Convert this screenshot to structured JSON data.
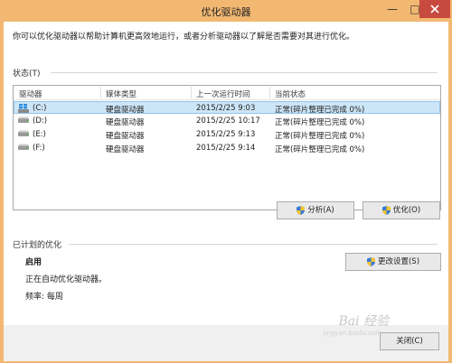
{
  "window": {
    "title": "优化驱动器",
    "minimize_glyph": "—",
    "maximize_glyph": "□",
    "accent_color": "#f2b872",
    "close_color": "#c7493f"
  },
  "intro_text": "你可以优化驱动器以帮助计算机更高效地运行，或者分析驱动器以了解是否需要对其进行优化。",
  "status": {
    "label": "状态(T)",
    "columns": [
      "驱动器",
      "媒体类型",
      "上一次运行时间",
      "当前状态"
    ],
    "rows": [
      {
        "drive": "(C:)",
        "icon": "windows-drive-icon",
        "media": "硬盘驱动器",
        "last_run": "2015/2/25 9:03",
        "state": "正常(碎片整理已完成 0%)",
        "selected": true
      },
      {
        "drive": "(D:)",
        "icon": "hard-drive-icon",
        "media": "硬盘驱动器",
        "last_run": "2015/2/25 10:17",
        "state": "正常(碎片整理已完成 0%)",
        "selected": false
      },
      {
        "drive": "(E:)",
        "icon": "hard-drive-icon",
        "media": "硬盘驱动器",
        "last_run": "2015/2/25 9:13",
        "state": "正常(碎片整理已完成 0%)",
        "selected": false
      },
      {
        "drive": "(F:)",
        "icon": "hard-drive-icon",
        "media": "硬盘驱动器",
        "last_run": "2015/2/25 9:14",
        "state": "正常(碎片整理已完成 0%)",
        "selected": false
      }
    ]
  },
  "buttons": {
    "analyze": "分析(A)",
    "optimize": "优化(O)",
    "change_settings": "更改设置(S)",
    "close": "关闭(C)"
  },
  "scheduled": {
    "label": "已计划的优化",
    "state": "启用",
    "description": "正在自动优化驱动器。",
    "frequency": "频率: 每周"
  },
  "watermark": {
    "brand": "Bai 经验",
    "url": "jingyan.baidu.com"
  }
}
